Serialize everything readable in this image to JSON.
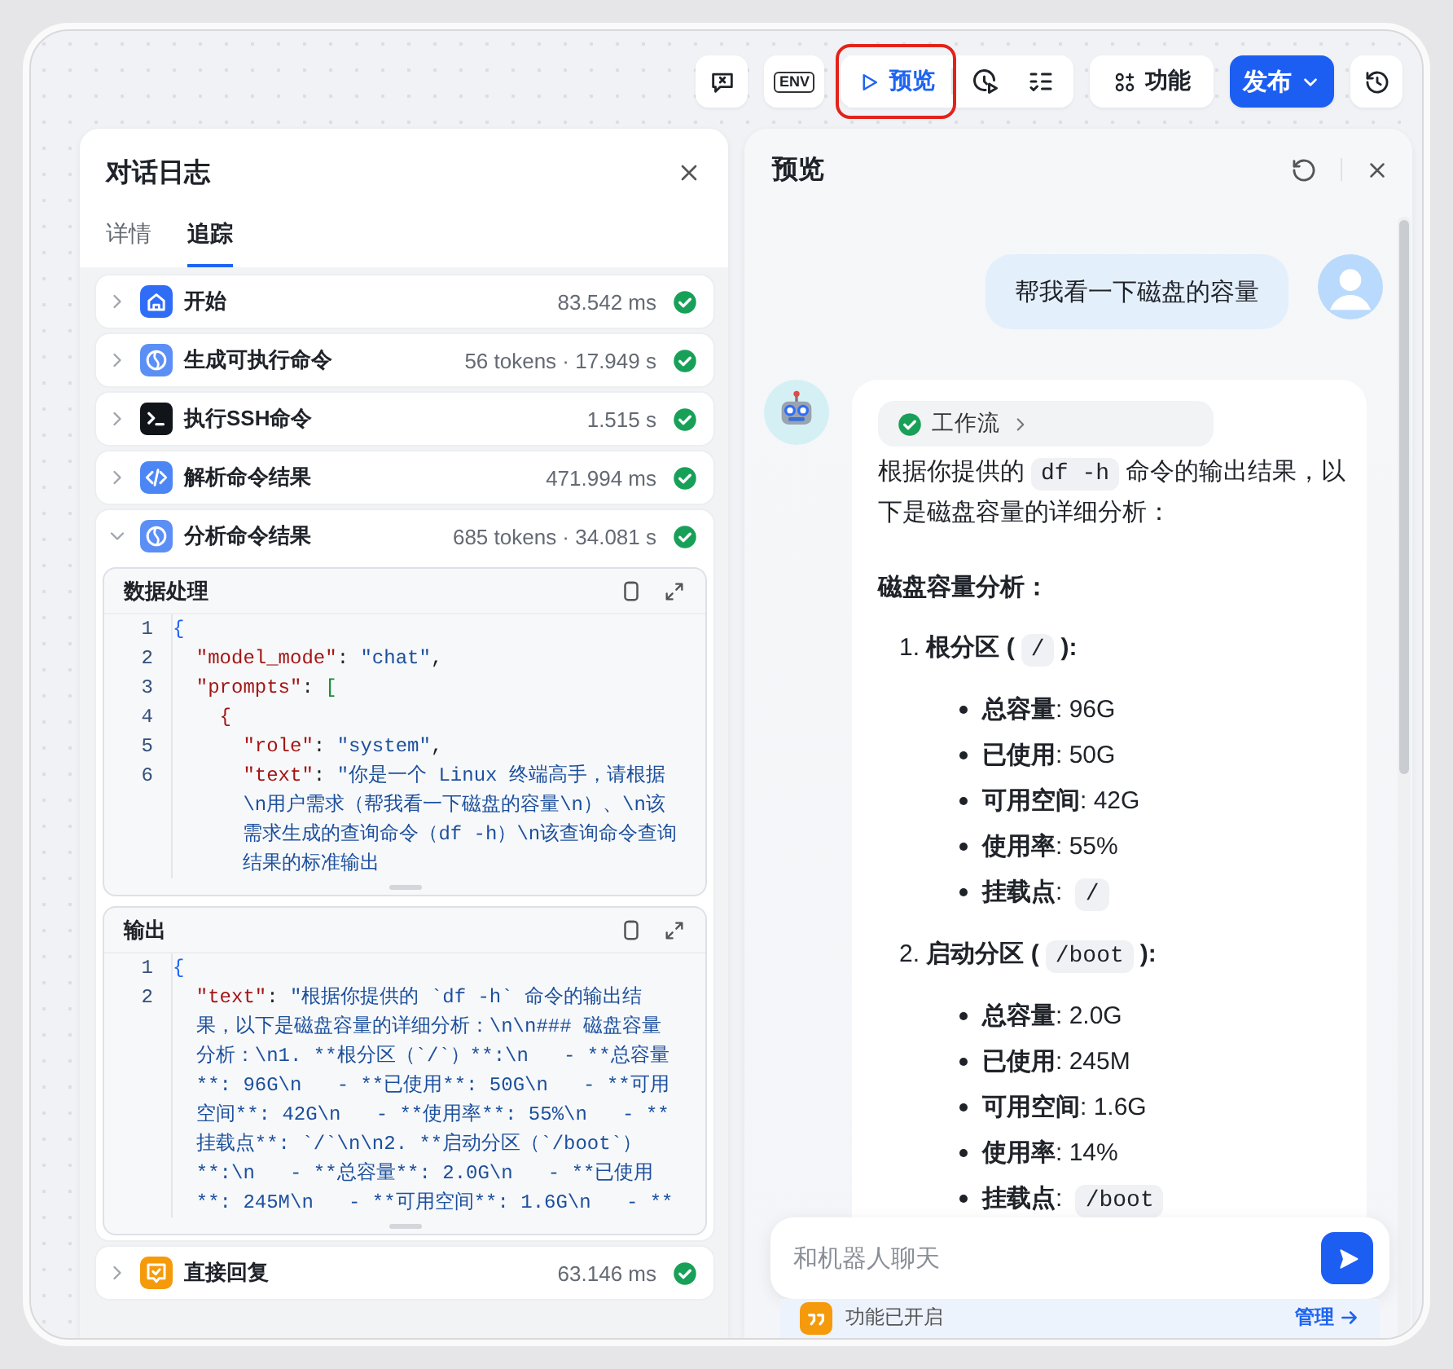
{
  "toolbar": [
    {
      "kind": "clear"
    },
    {
      "kind": "env",
      "label": "ENV"
    },
    {
      "kind": "group",
      "items": [
        {
          "kind": "preview",
          "label": "预览",
          "highlighted": true
        },
        {
          "kind": "debug"
        },
        {
          "kind": "checklist"
        }
      ]
    },
    {
      "kind": "features",
      "label": "功能"
    },
    {
      "kind": "publish",
      "label": "发布"
    },
    {
      "kind": "history"
    }
  ],
  "log": {
    "title": "对话日志",
    "tabs": [
      {
        "label": "详情",
        "selected": false
      },
      {
        "label": "追踪",
        "selected": true
      }
    ],
    "steps": [
      {
        "kind": "start",
        "label": "开始",
        "meta": "83.542 ms",
        "succeeded": true,
        "expanded": false
      },
      {
        "kind": "llm",
        "label": "生成可执行命令",
        "meta": "56 tokens · 17.949 s",
        "succeeded": true,
        "expanded": false
      },
      {
        "kind": "ssh",
        "label": "执行SSH命令",
        "meta": "1.515 s",
        "succeeded": true,
        "expanded": false
      },
      {
        "kind": "code",
        "label": "解析命令结果",
        "meta": "471.994 ms",
        "succeeded": true,
        "expanded": false
      },
      {
        "kind": "llm",
        "label": "分析命令结果",
        "meta": "685 tokens · 34.081 s",
        "succeeded": true,
        "expanded": true,
        "sections": [
          {
            "title": "数据处理",
            "rows": [
              {
                "number": "1",
                "tokens": [
                  {
                    "kind": "brace",
                    "text": "{"
                  }
                ]
              },
              {
                "number": "2",
                "tokens": [
                  {
                    "kind": "key",
                    "text": "  \"model_mode\""
                  },
                  {
                    "kind": "punct",
                    "text": ": "
                  },
                  {
                    "kind": "string",
                    "text": "\"chat\""
                  },
                  {
                    "kind": "punct",
                    "text": ","
                  }
                ]
              },
              {
                "number": "3",
                "tokens": [
                  {
                    "kind": "key",
                    "text": "  \"prompts\""
                  },
                  {
                    "kind": "punct",
                    "text": ": "
                  },
                  {
                    "kind": "bracket",
                    "text": "["
                  }
                ]
              },
              {
                "number": "4",
                "tokens": [
                  {
                    "kind": "brace2",
                    "text": "    {"
                  }
                ]
              },
              {
                "number": "5",
                "tokens": [
                  {
                    "kind": "key",
                    "text": "      \"role\""
                  },
                  {
                    "kind": "punct",
                    "text": ": "
                  },
                  {
                    "kind": "string",
                    "text": "\"system\""
                  },
                  {
                    "kind": "punct",
                    "text": ","
                  }
                ]
              },
              {
                "number": "6",
                "tokens": [
                  {
                    "kind": "key",
                    "text": "      \"text\""
                  },
                  {
                    "kind": "punct",
                    "text": ": "
                  },
                  {
                    "kind": "string",
                    "text": "\"你是一个 Linux 终端高手，请根据"
                  }
                ]
              },
              {
                "tokens": [
                  {
                    "kind": "string",
                    "text": "      \\n用户需求（帮我看一下磁盘的容量\\n）、\\n该"
                  }
                ]
              },
              {
                "tokens": [
                  {
                    "kind": "string",
                    "text": "      需求生成的查询命令（df -h）\\n该查询命令查询"
                  }
                ]
              },
              {
                "tokens": [
                  {
                    "kind": "string",
                    "text": "      结果的标准输出"
                  }
                ]
              }
            ]
          },
          {
            "title": "输出",
            "rows": [
              {
                "number": "1",
                "tokens": [
                  {
                    "kind": "brace",
                    "text": "{"
                  }
                ]
              },
              {
                "number": "2",
                "tokens": [
                  {
                    "kind": "key",
                    "text": "  \"text\""
                  },
                  {
                    "kind": "punct",
                    "text": ": "
                  },
                  {
                    "kind": "string",
                    "text": "\"根据你提供的 `df -h` 命令的输出结"
                  }
                ]
              },
              {
                "tokens": [
                  {
                    "kind": "string",
                    "text": "  果，以下是磁盘容量的详细分析：\\n\\n### 磁盘容量"
                  }
                ]
              },
              {
                "tokens": [
                  {
                    "kind": "string",
                    "text": "  分析：\\n1. **根分区（`/`）**:\\n   - **总容量"
                  }
                ]
              },
              {
                "tokens": [
                  {
                    "kind": "string",
                    "text": "  **: 96G\\n   - **已使用**: 50G\\n   - **可用"
                  }
                ]
              },
              {
                "tokens": [
                  {
                    "kind": "string",
                    "text": "  空间**: 42G\\n   - **使用率**: 55%\\n   - **"
                  }
                ]
              },
              {
                "tokens": [
                  {
                    "kind": "string",
                    "text": "  挂载点**: `/`\\n\\n2. **启动分区（`/boot`）"
                  }
                ]
              },
              {
                "tokens": [
                  {
                    "kind": "string",
                    "text": "  **:\\n   - **总容量**: 2.0G\\n   - **已使用"
                  }
                ]
              },
              {
                "tokens": [
                  {
                    "kind": "string",
                    "text": "  **: 245M\\n   - **可用空间**: 1.6G\\n   - **"
                  }
                ]
              }
            ]
          }
        ]
      },
      {
        "kind": "reply",
        "label": "直接回复",
        "meta": "63.146 ms",
        "succeeded": true,
        "expanded": false
      }
    ]
  },
  "preview": {
    "title": "预览",
    "messages": [
      {
        "kind": "user",
        "text": "帮我看一下磁盘的容量"
      },
      {
        "kind": "bot",
        "workflow": {
          "label": "工作流",
          "succeeded": true
        },
        "blocks": [
          {
            "kind": "paragraph",
            "segments": [
              {
                "kind": "text",
                "text": "根据你提供的"
              },
              {
                "kind": "code",
                "text": "df -h"
              },
              {
                "kind": "text",
                "text": "命令的输出结果，以下是磁盘容量的详细分析："
              }
            ]
          },
          {
            "kind": "heading",
            "text": "磁盘容量分析："
          },
          {
            "kind": "list-item",
            "number": "1.",
            "segments": [
              {
                "kind": "bold",
                "text": "根分区 ("
              },
              {
                "kind": "code",
                "text": "/"
              },
              {
                "kind": "bold",
                "text": "):"
              }
            ],
            "bullets": [
              {
                "segments": [
                  {
                    "kind": "bold",
                    "text": "总容量"
                  },
                  {
                    "kind": "text",
                    "text": ": 96G"
                  }
                ]
              },
              {
                "segments": [
                  {
                    "kind": "bold",
                    "text": "已使用"
                  },
                  {
                    "kind": "text",
                    "text": ": 50G"
                  }
                ]
              },
              {
                "segments": [
                  {
                    "kind": "bold",
                    "text": "可用空间"
                  },
                  {
                    "kind": "text",
                    "text": ": 42G"
                  }
                ]
              },
              {
                "segments": [
                  {
                    "kind": "bold",
                    "text": "使用率"
                  },
                  {
                    "kind": "text",
                    "text": ": 55%"
                  }
                ]
              },
              {
                "segments": [
                  {
                    "kind": "bold",
                    "text": "挂载点"
                  },
                  {
                    "kind": "text",
                    "text": ": "
                  },
                  {
                    "kind": "code",
                    "text": "/"
                  }
                ]
              }
            ]
          },
          {
            "kind": "list-item",
            "number": "2.",
            "segments": [
              {
                "kind": "bold",
                "text": "启动分区 ("
              },
              {
                "kind": "code",
                "text": "/boot"
              },
              {
                "kind": "bold",
                "text": "):"
              }
            ],
            "bullets": [
              {
                "segments": [
                  {
                    "kind": "bold",
                    "text": "总容量"
                  },
                  {
                    "kind": "text",
                    "text": ": 2.0G"
                  }
                ]
              },
              {
                "segments": [
                  {
                    "kind": "bold",
                    "text": "已使用"
                  },
                  {
                    "kind": "text",
                    "text": ": 245M"
                  }
                ]
              },
              {
                "segments": [
                  {
                    "kind": "bold",
                    "text": "可用空间"
                  },
                  {
                    "kind": "text",
                    "text": ": 1.6G"
                  }
                ]
              },
              {
                "segments": [
                  {
                    "kind": "bold",
                    "text": "使用率"
                  },
                  {
                    "kind": "text",
                    "text": ": 14%"
                  }
                ]
              },
              {
                "segments": [
                  {
                    "kind": "bold",
                    "text": "挂载点"
                  },
                  {
                    "kind": "text",
                    "text": ": "
                  },
                  {
                    "kind": "code",
                    "text": "/boot"
                  }
                ]
              }
            ]
          }
        ]
      }
    ],
    "input": {
      "placeholder": "和机器人聊天"
    },
    "banner": {
      "text": "功能已开启",
      "link": "管理"
    }
  }
}
